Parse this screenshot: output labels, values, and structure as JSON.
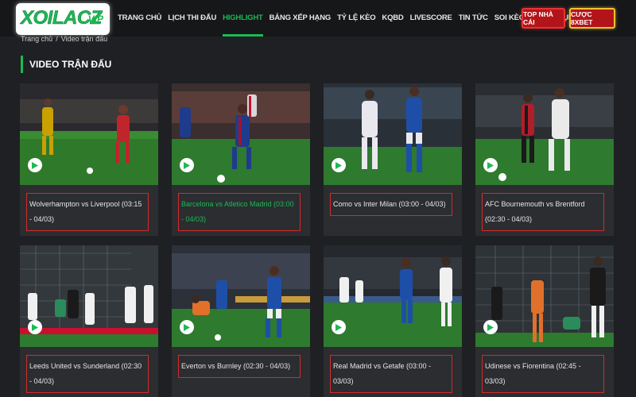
{
  "header": {
    "logo_text": "XOILACZ",
    "logo_suffix": ".VIP",
    "nav": [
      {
        "label": "TRANG CHỦ"
      },
      {
        "label": "LỊCH THI ĐẤU"
      },
      {
        "label": "HIGHLIGHT",
        "active": true
      },
      {
        "label": "BẢNG XẾP HẠNG"
      },
      {
        "label": "TỶ LỆ KÈO"
      },
      {
        "label": "KQBD"
      },
      {
        "label": "LIVESCORE"
      },
      {
        "label": "TIN TỨC"
      },
      {
        "label": "SOI KÈO"
      },
      {
        "label": "TUYỂN DỤNG"
      }
    ],
    "btn_top_label": "TOP NHÀ CÁI",
    "btn_8x_label": "CƯỢC 8XBET"
  },
  "breadcrumb": {
    "home": "Trang chủ",
    "separator": "/",
    "current": "Video trận đấu"
  },
  "section_title": "VIDEO TRẬN ĐẤU",
  "colors": {
    "accent": "#1db954",
    "header_bg": "#151719",
    "page_bg": "#1e2023",
    "card_bg": "#2b2d31",
    "title_border": "#d52b2b",
    "button_red": "#b3141a"
  },
  "videos": [
    {
      "title": "Wolverhampton vs Liverpool (03:15 - 04/03)",
      "icon": "play-icon"
    },
    {
      "title": "Barcelona vs Atletico Madrid (03:00 - 04/03)",
      "highlight": true,
      "icon": "play-icon"
    },
    {
      "title": "Como vs Inter Milan (03:00 - 04/03)",
      "icon": "play-icon"
    },
    {
      "title": "AFC Bournemouth vs Brentford (02:30 - 04/03)",
      "icon": "play-icon"
    },
    {
      "title": "Leeds United vs Sunderland (02:30 - 04/03)",
      "icon": "play-icon"
    },
    {
      "title": "Everton vs Burnley (02:30 - 04/03)",
      "icon": "play-icon"
    },
    {
      "title": "Real Madrid vs Getafe (03:00 - 03/03)",
      "icon": "play-icon"
    },
    {
      "title": "Udinese vs Fiorentina (02:45 - 03/03)",
      "icon": "play-icon"
    }
  ]
}
